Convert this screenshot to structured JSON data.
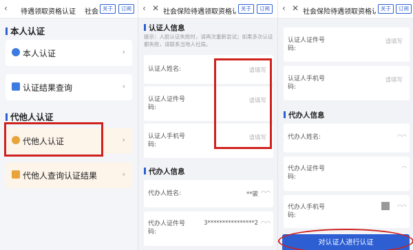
{
  "panel1": {
    "header": {
      "title": "待遇领取资格认证",
      "title_extra": "社会",
      "btn_about": "关于",
      "btn_sub": "订阅"
    },
    "section_self": "本人认证",
    "self_items": [
      {
        "label": "本人认证",
        "icon": "person-icon"
      },
      {
        "label": "认证结果查询",
        "icon": "document-icon"
      }
    ],
    "section_agent": "代他人认证",
    "agent_items": [
      {
        "label": "代他人认证",
        "icon": "person-icon"
      },
      {
        "label": "代他人查询认证结果",
        "icon": "document-icon"
      }
    ],
    "chevron": "›"
  },
  "panel2": {
    "header": {
      "title": "社会保险待遇领取资格认",
      "btn_about": "关于",
      "btn_sub": "订阅"
    },
    "section_certified": "认证人信息",
    "tip": "提示：人脸认证失败时，请再次重新尝试；如果多次认证都失败，请联系当地人社局。",
    "certified_fields": [
      {
        "label": "认证人姓名:",
        "placeholder": "请填写"
      },
      {
        "label": "认证人证件号码:",
        "placeholder": "请填写"
      },
      {
        "label": "认证人手机号码:",
        "placeholder": "请填写"
      }
    ],
    "section_agent": "代办人信息",
    "agent_fields": [
      {
        "label": "代办人姓名:",
        "value": "**骏"
      },
      {
        "label": "代办人证件号码:",
        "value": "3****************2"
      }
    ]
  },
  "panel3": {
    "header": {
      "title": "社会保险待遇领取资格认",
      "btn_about": "关于",
      "btn_sub": "订阅"
    },
    "certified_fields": [
      {
        "label": "认证人证件号码:",
        "placeholder": "请填写"
      },
      {
        "label": "认证人手机号码:",
        "placeholder": "请填写"
      }
    ],
    "section_agent": "代办人信息",
    "agent_fields": [
      {
        "label": "代办人姓名:"
      },
      {
        "label": "代办人证件号码:"
      },
      {
        "label": "代办人手机号码:"
      }
    ],
    "submit": "对认证人进行认证"
  },
  "colors": {
    "accent": "#2d5fd3",
    "highlight": "#d0201b"
  }
}
